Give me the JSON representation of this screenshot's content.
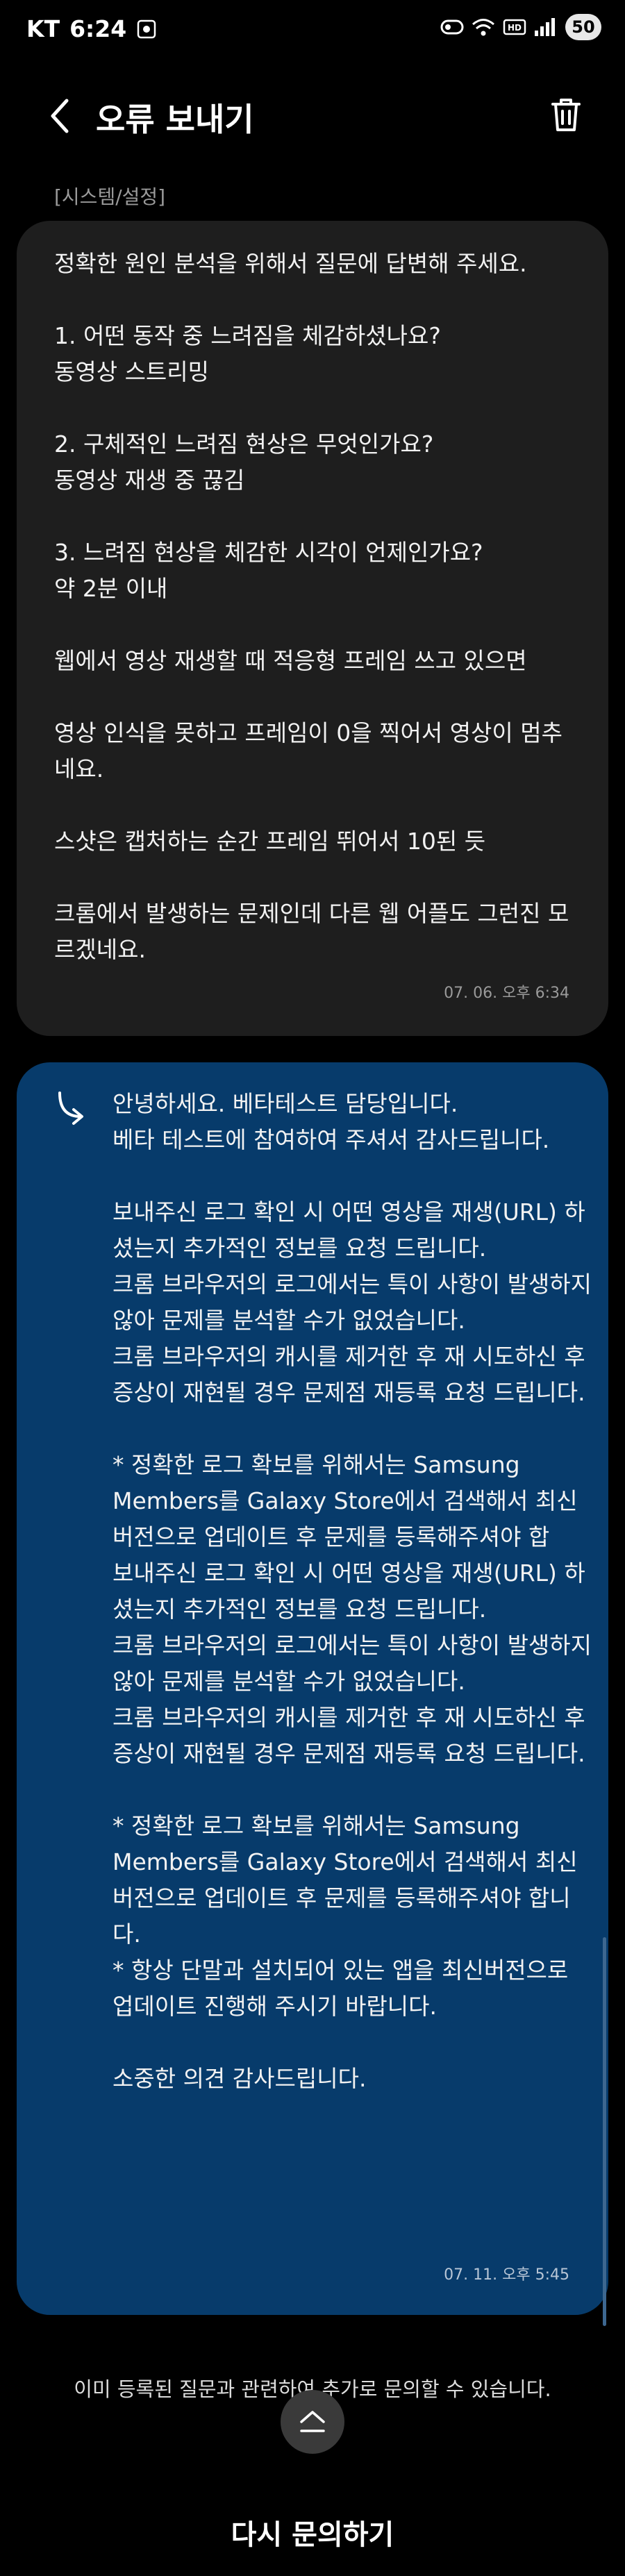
{
  "status_bar": {
    "carrier": "KT",
    "time": "6:24",
    "battery": "50"
  },
  "header": {
    "title": "오류 보내기"
  },
  "category": "[시스템/설정]",
  "question": {
    "text": "정확한 원인 분석을 위해서 질문에 답변해 주세요.\n\n1. 어떤 동작 중 느려짐을 체감하셨나요?\n동영상 스트리밍\n\n2. 구체적인 느려짐 현상은 무엇인가요?\n동영상 재생 중 끊김\n\n3. 느려짐 현상을 체감한 시각이 언제인가요?\n약 2분 이내\n\n웹에서 영상 재생할 때 적응형 프레임 쓰고 있으면\n\n영상 인식을 못하고 프레임이 0을 찍어서 영상이 멈추네요.\n\n스샷은 캡처하는 순간 프레임 뛰어서 10된 듯\n\n크롬에서 발생하는 문제인데 다른 웹 어플도 그런진 모르겠네요.",
    "date": "07. 06. 오후 6:34"
  },
  "answer": {
    "text": "안녕하세요. 베타테스트 담당입니다.\n베타 테스트에 참여하여 주셔서 감사드립니다.\n\n보내주신 로그 확인 시 어떤 영상을 재생(URL) 하셨는지 추가적인 정보를 요청 드립니다.\n크롬 브라우저의 로그에서는 특이 사항이 발생하지 않아 문제를 분석할 수가 없었습니다.\n크롬 브라우저의 캐시를 제거한 후 재 시도하신 후 증상이 재현될 경우 문제점 재등록 요청 드립니다.\n\n* 정확한 로그 확보를 위해서는 Samsung Members를 Galaxy Store에서 검색해서 최신 버전으로 업데이트 후 문제를 등록해주셔야 합\n보내주신 로그 확인 시 어떤 영상을 재생(URL) 하셨는지 추가적인 정보를 요청 드립니다.\n크롬 브라우저의 로그에서는 특이 사항이 발생하지 않아 문제를 분석할 수가 없었습니다.\n크롬 브라우저의 캐시를 제거한 후 재 시도하신 후 증상이 재현될 경우 문제점 재등록 요청 드립니다.\n\n* 정확한 로그 확보를 위해서는 Samsung Members를 Galaxy Store에서 검색해서 최신 버전으로 업데이트 후 문제를 등록해주셔야 합니다.\n* 항상 단말과 설치되어 있는 앱을 최신버전으로 업데이트 진행해 주시기 바랍니다.\n\n소중한 의견 감사드립니다.",
    "date": "07. 11. 오후 5:45"
  },
  "notice": "이미 등록된 질문과 관련하여 추가로 문의할 수 있습니다.",
  "inquire_button": "다시 문의하기",
  "colors": {
    "question_bg": "#1e1e1e",
    "answer_bg": "#073b6b"
  }
}
